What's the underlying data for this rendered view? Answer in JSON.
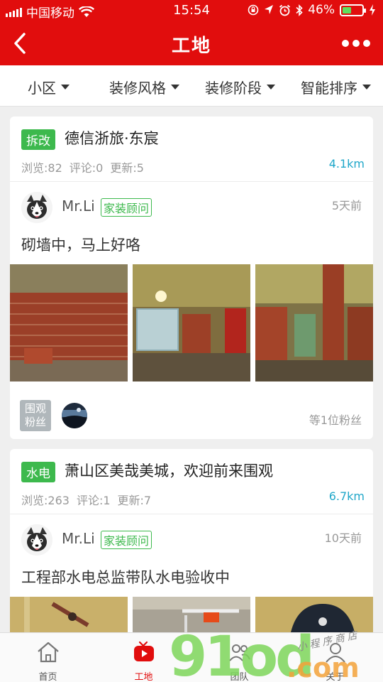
{
  "status_bar": {
    "carrier": "中国移动",
    "time": "15:54",
    "battery_text": "46%",
    "battery_level": 0.46
  },
  "nav": {
    "title": "工地",
    "back_icon": "chevron-left-icon",
    "more_icon": "more-dots-icon"
  },
  "filters": [
    {
      "label": "小区"
    },
    {
      "label": "装修风格"
    },
    {
      "label": "装修阶段"
    },
    {
      "label": "智能排序"
    }
  ],
  "cards": [
    {
      "tag": "拆改",
      "title": "德信浙旅·东宸",
      "views": "浏览:82",
      "comments": "评论:0",
      "updates": "更新:5",
      "distance": "4.1km",
      "post": {
        "author": "Mr.Li",
        "role": "家装顾问",
        "time": "5天前",
        "text": "砌墙中，马上好咯"
      },
      "watch_badge": [
        "围观",
        "粉丝"
      ],
      "fans_text": "等1位粉丝"
    },
    {
      "tag": "水电",
      "title": "萧山区美哉美城，欢迎前来围观",
      "views": "浏览:263",
      "comments": "评论:1",
      "updates": "更新:7",
      "distance": "6.7km",
      "post": {
        "author": "Mr.Li",
        "role": "家装顾问",
        "time": "10天前",
        "text": "工程部水电总监带队水电验收中"
      }
    }
  ],
  "tabs": [
    {
      "label": "首页",
      "icon": "home-icon"
    },
    {
      "label": "工地",
      "icon": "tv-play-icon"
    },
    {
      "label": "团队",
      "icon": "team-icon"
    },
    {
      "label": "关于",
      "icon": "user-icon"
    }
  ],
  "watermark": {
    "big": "91od",
    "com": ".com",
    "small": "小程序商店"
  },
  "colors": {
    "brand_red": "#e10d0d",
    "tag_green": "#3db94d",
    "distance_blue": "#20a7c9"
  }
}
